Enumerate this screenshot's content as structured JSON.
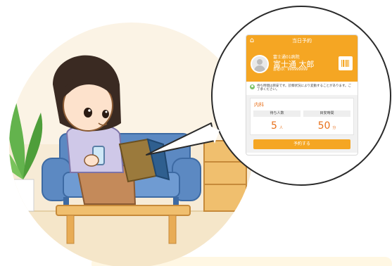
{
  "app": {
    "title": "当日予約",
    "hospital_name": "富士通01病院",
    "patient_name": "富士通 太郎",
    "patient_id": "患者ID：999999999",
    "notice": "待ち時間は目安です。診察状況により変動することがあります。ご了承ください。",
    "department": "内科",
    "waiting_label": "待ち人数",
    "waiting_count": "5",
    "waiting_unit": "人",
    "time_label": "目安時間",
    "time_value": "50",
    "time_unit": "分",
    "reserve_button": "予約する"
  },
  "colors": {
    "accent": "#f5a623",
    "accent_text": "#e8711c",
    "floor": "#f5e6c9",
    "sofa": "#5c89c2"
  },
  "icons": [
    "home-icon",
    "avatar-icon",
    "barcode-icon",
    "info-icon",
    "plant-icon",
    "phone-icon",
    "tablet-icon"
  ]
}
